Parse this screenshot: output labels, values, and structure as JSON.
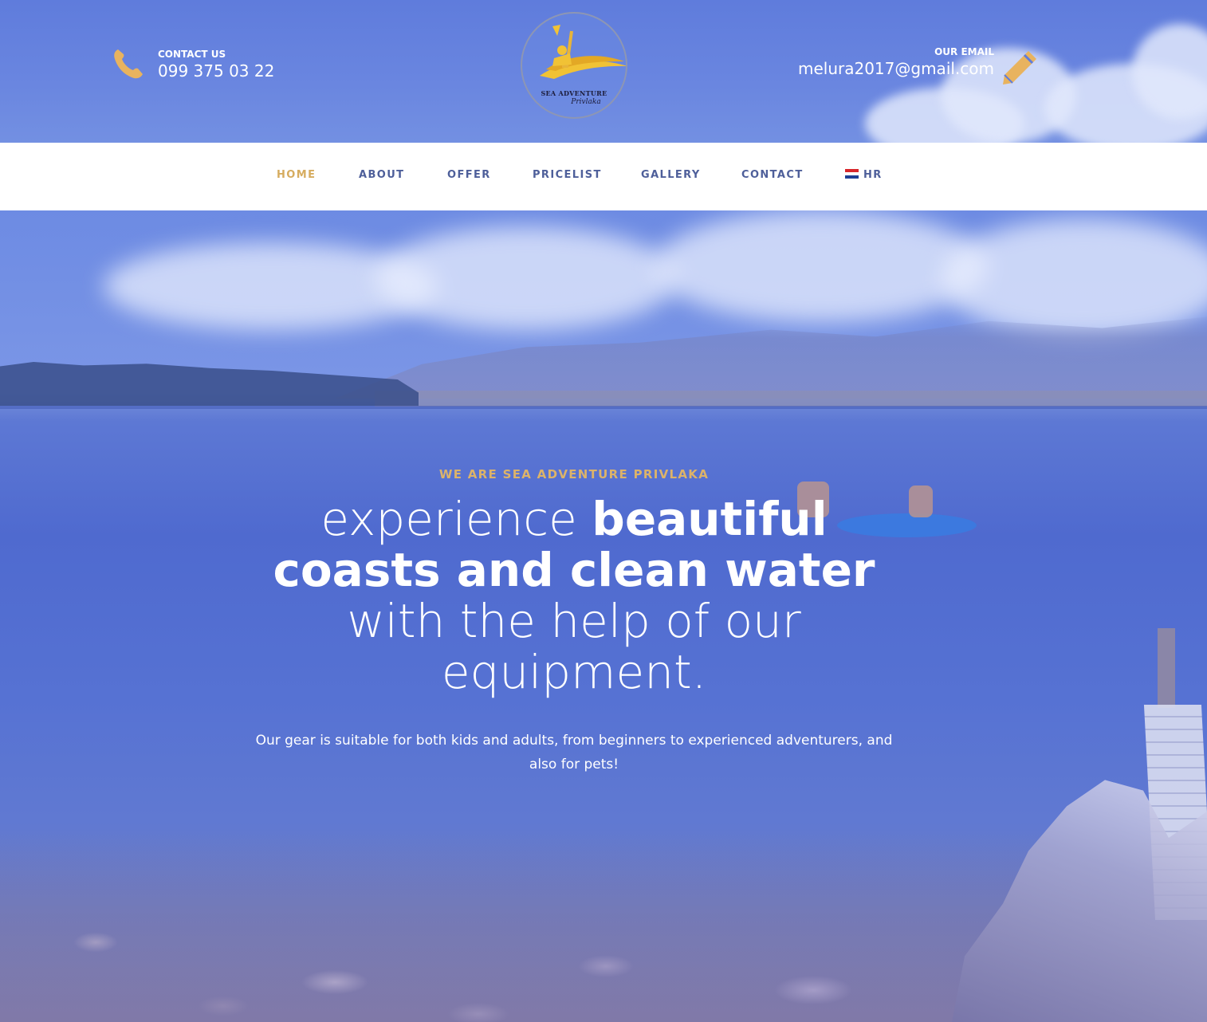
{
  "header": {
    "contact_label": "CONTACT US",
    "contact_phone": "099 375 03 22",
    "email_label": "OUR EMAIL",
    "email_value": "melura2017@gmail.com",
    "logo": {
      "title": "SEA ADVENTURE",
      "subtitle": "Privlaka"
    }
  },
  "nav": {
    "items": [
      {
        "label": "HOME",
        "active": true
      },
      {
        "label": "ABOUT"
      },
      {
        "label": "OFFER"
      },
      {
        "label": "PRICELIST"
      },
      {
        "label": "GALLERY"
      },
      {
        "label": "CONTACT"
      }
    ],
    "language": {
      "label": "HR",
      "icon": "croatian-flag-icon"
    }
  },
  "hero": {
    "tagline": "WE ARE SEA ADVENTURE PRIVLAKA",
    "headline": {
      "light1": "experience ",
      "bold1": "beautiful",
      "bold2": "coasts and clean water",
      "light2": "with the help of our",
      "light3": "equipment."
    },
    "description": "Our gear is suitable for both kids and adults, from beginners to experienced adventurers, and also for pets!"
  },
  "colors": {
    "accent_gold": "#d6ac5f",
    "nav_text": "#4e5f9a",
    "header_blue": "#5f7cdc",
    "overlay_blue": "#5672d3"
  },
  "icons": {
    "phone": "phone-icon",
    "email": "pencil-icon",
    "logo": "kayaker-logo-icon"
  }
}
